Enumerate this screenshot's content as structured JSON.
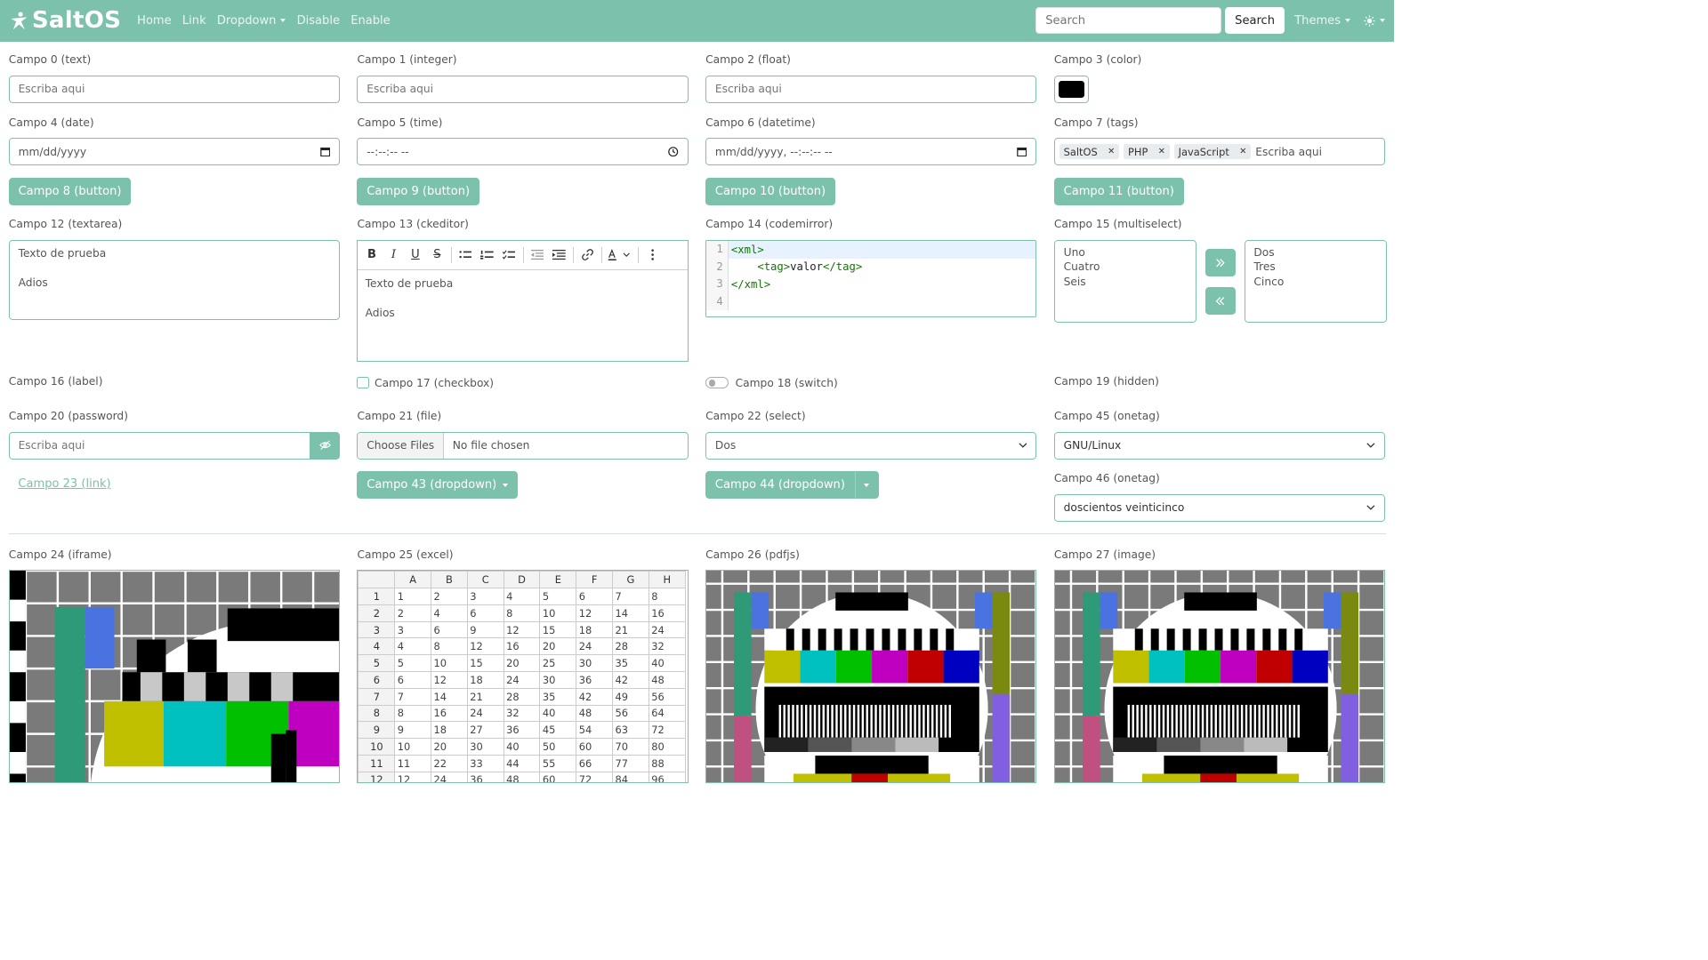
{
  "navbar": {
    "brand": "SaltOS",
    "links": [
      "Home",
      "Link",
      "Dropdown",
      "Disable",
      "Enable"
    ],
    "search_placeholder": "Search",
    "search_button": "Search",
    "themes": "Themes",
    "color": "#7cc1ab"
  },
  "fields": {
    "f0": {
      "label": "Campo 0 (text)",
      "placeholder": "Escriba aqui"
    },
    "f1": {
      "label": "Campo 1 (integer)",
      "placeholder": "Escriba aqui"
    },
    "f2": {
      "label": "Campo 2 (float)",
      "placeholder": "Escriba aqui"
    },
    "f3": {
      "label": "Campo 3 (color)",
      "value": "#000000"
    },
    "f4": {
      "label": "Campo 4 (date)",
      "placeholder": "mm/dd/yyyy"
    },
    "f5": {
      "label": "Campo 5 (time)",
      "placeholder": "--:--:-- --"
    },
    "f6": {
      "label": "Campo 6 (datetime)",
      "placeholder": "mm/dd/yyyy, --:--:-- --"
    },
    "f7": {
      "label": "Campo 7 (tags)",
      "tags": [
        "SaltOS",
        "PHP",
        "JavaScript"
      ],
      "placeholder": "Escriba aqui"
    },
    "f8": {
      "label": "Campo 8 (button)"
    },
    "f9": {
      "label": "Campo 9 (button)"
    },
    "f10": {
      "label": "Campo 10 (button)"
    },
    "f11": {
      "label": "Campo 11 (button)"
    },
    "f12": {
      "label": "Campo 12 (textarea)",
      "line1": "Texto de prueba",
      "line2": "Adios"
    },
    "f13": {
      "label": "Campo 13 (ckeditor)",
      "line1": "Texto de prueba",
      "line2": "Adios"
    },
    "f14": {
      "label": "Campo 14 (codemirror)",
      "line_numbers": [
        "1",
        "2",
        "3",
        "4"
      ],
      "l1": "<xml>",
      "l2_open": "<tag>",
      "l2_val": "valor",
      "l2_close": "</tag>",
      "l3": "</xml>"
    },
    "f15": {
      "label": "Campo 15 (multiselect)",
      "left": [
        "Uno",
        "Cuatro",
        "Seis"
      ],
      "right": [
        "Dos",
        "Tres",
        "Cinco"
      ]
    },
    "f16": {
      "label": "Campo 16 (label)"
    },
    "f17": {
      "label": "Campo 17 (checkbox)"
    },
    "f18": {
      "label": "Campo 18 (switch)"
    },
    "f19": {
      "label": "Campo 19 (hidden)"
    },
    "f20": {
      "label": "Campo 20 (password)",
      "placeholder": "Escriba aqui"
    },
    "f21": {
      "label": "Campo 21 (file)",
      "button": "Choose Files",
      "status": "No file chosen"
    },
    "f22": {
      "label": "Campo 22 (select)",
      "value": "Dos"
    },
    "f45": {
      "label": "Campo 45 (onetag)",
      "value": "GNU/Linux"
    },
    "f23": {
      "label": "Campo 23 (link)"
    },
    "f43": {
      "label": "Campo 43 (dropdown)"
    },
    "f44": {
      "label": "Campo 44 (dropdown)"
    },
    "f46": {
      "label": "Campo 46 (onetag)",
      "value": "doscientos veinticinco"
    },
    "f24": {
      "label": "Campo 24 (iframe)"
    },
    "f25": {
      "label": "Campo 25 (excel)"
    },
    "f26": {
      "label": "Campo 26 (pdfjs)"
    },
    "f27": {
      "label": "Campo 27 (image)"
    }
  },
  "excel": {
    "columns": [
      "A",
      "B",
      "C",
      "D",
      "E",
      "F",
      "G",
      "H"
    ],
    "rows": [
      [
        "1",
        "1",
        "2",
        "3",
        "4",
        "5",
        "6",
        "7",
        "8"
      ],
      [
        "2",
        "2",
        "4",
        "6",
        "8",
        "10",
        "12",
        "14",
        "16"
      ],
      [
        "3",
        "3",
        "6",
        "9",
        "12",
        "15",
        "18",
        "21",
        "24"
      ],
      [
        "4",
        "4",
        "8",
        "12",
        "16",
        "20",
        "24",
        "28",
        "32"
      ],
      [
        "5",
        "5",
        "10",
        "15",
        "20",
        "25",
        "30",
        "35",
        "40"
      ],
      [
        "6",
        "6",
        "12",
        "18",
        "24",
        "30",
        "36",
        "42",
        "48"
      ],
      [
        "7",
        "7",
        "14",
        "21",
        "28",
        "35",
        "42",
        "49",
        "56"
      ],
      [
        "8",
        "8",
        "16",
        "24",
        "32",
        "40",
        "48",
        "56",
        "64"
      ],
      [
        "9",
        "9",
        "18",
        "27",
        "36",
        "45",
        "54",
        "63",
        "72"
      ],
      [
        "10",
        "10",
        "20",
        "30",
        "40",
        "50",
        "60",
        "70",
        "80"
      ],
      [
        "11",
        "11",
        "22",
        "33",
        "44",
        "55",
        "66",
        "77",
        "88"
      ],
      [
        "12",
        "12",
        "24",
        "36",
        "48",
        "60",
        "72",
        "84",
        "96"
      ]
    ]
  },
  "test_pattern_colors": [
    "#c0c000",
    "#00c0c0",
    "#00c000",
    "#c000c0",
    "#c00000",
    "#0000c0"
  ]
}
